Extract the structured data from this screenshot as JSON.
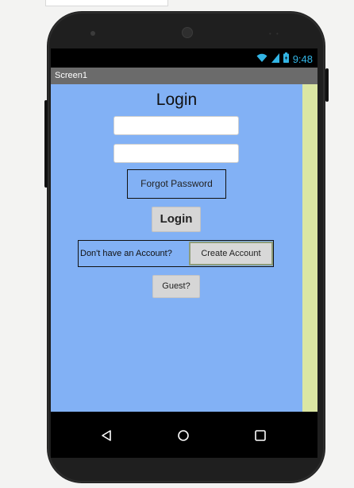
{
  "status_bar": {
    "time": "9:48",
    "icons": [
      "wifi-icon",
      "signal-icon",
      "battery-icon"
    ]
  },
  "title_bar": {
    "title": "Screen1"
  },
  "login_screen": {
    "title": "Login",
    "username_input": {
      "value": "",
      "placeholder": ""
    },
    "password_input": {
      "value": "",
      "placeholder": ""
    },
    "forgot_password_label": "Forgot Password",
    "login_button_label": "Login",
    "account_prompt": "Don't have an Account?",
    "create_account_button_label": "Create Account",
    "guest_button_label": "Guest?"
  },
  "navigation": {
    "icons": [
      "back-icon",
      "home-icon",
      "recents-icon"
    ]
  },
  "colors": {
    "app_background": "#82b1f5",
    "side_strip": "#dbe6a3",
    "title_bar": "#6b6b6b",
    "status_icons": "#33b5e5",
    "button_gray": "#d6d6d6"
  }
}
